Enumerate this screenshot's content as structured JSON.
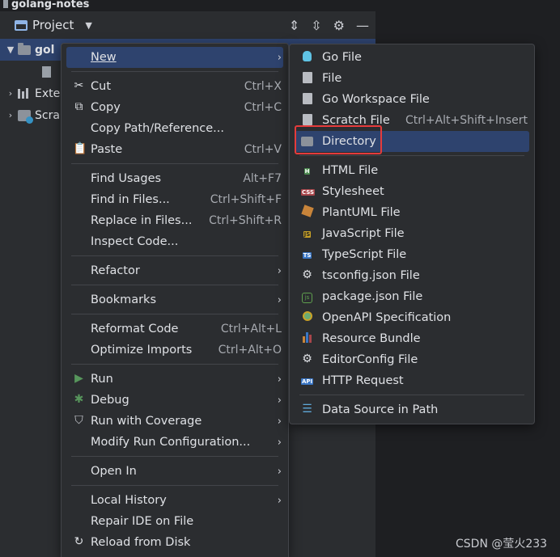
{
  "window": {
    "title": "golang-notes"
  },
  "panel": {
    "title": "Project",
    "tree": [
      {
        "label": "gol",
        "expanded": true,
        "bold": true
      },
      {
        "label": ""
      },
      {
        "label": "Exte",
        "expanded": false
      },
      {
        "label": "Scra",
        "expanded": false
      }
    ]
  },
  "context_menu": {
    "new": "New",
    "cut": "Cut",
    "cut_sc": "Ctrl+X",
    "copy": "Copy",
    "copy_sc": "Ctrl+C",
    "copy_path": "Copy Path/Reference...",
    "paste": "Paste",
    "paste_sc": "Ctrl+V",
    "find_usages": "Find Usages",
    "find_usages_sc": "Alt+F7",
    "find_in_files": "Find in Files...",
    "find_in_files_sc": "Ctrl+Shift+F",
    "replace_in_files": "Replace in Files...",
    "replace_in_files_sc": "Ctrl+Shift+R",
    "inspect_code": "Inspect Code...",
    "refactor": "Refactor",
    "bookmarks": "Bookmarks",
    "reformat_code": "Reformat Code",
    "reformat_code_sc": "Ctrl+Alt+L",
    "optimize_imports": "Optimize Imports",
    "optimize_imports_sc": "Ctrl+Alt+O",
    "run": "Run",
    "debug": "Debug",
    "run_coverage": "Run with Coverage",
    "modify_run": "Modify Run Configuration...",
    "open_in": "Open In",
    "local_history": "Local History",
    "repair_ide": "Repair IDE on File",
    "reload": "Reload from Disk"
  },
  "new_submenu": {
    "go_file": "Go File",
    "file": "File",
    "go_workspace": "Go Workspace File",
    "scratch": "Scratch File",
    "scratch_sc": "Ctrl+Alt+Shift+Insert",
    "directory": "Directory",
    "html": "HTML File",
    "stylesheet": "Stylesheet",
    "plantuml": "PlantUML File",
    "javascript": "JavaScript File",
    "typescript": "TypeScript File",
    "tsconfig": "tsconfig.json File",
    "package_json": "package.json File",
    "openapi": "OpenAPI Specification",
    "resource_bundle": "Resource Bundle",
    "editorconfig": "EditorConfig File",
    "http_request": "HTTP Request",
    "data_source": "Data Source in Path"
  },
  "watermark": "CSDN @莹火233",
  "colors": {
    "background": "#2b2d30",
    "highlight": "#2e436e",
    "callout": "#e53b3b"
  }
}
